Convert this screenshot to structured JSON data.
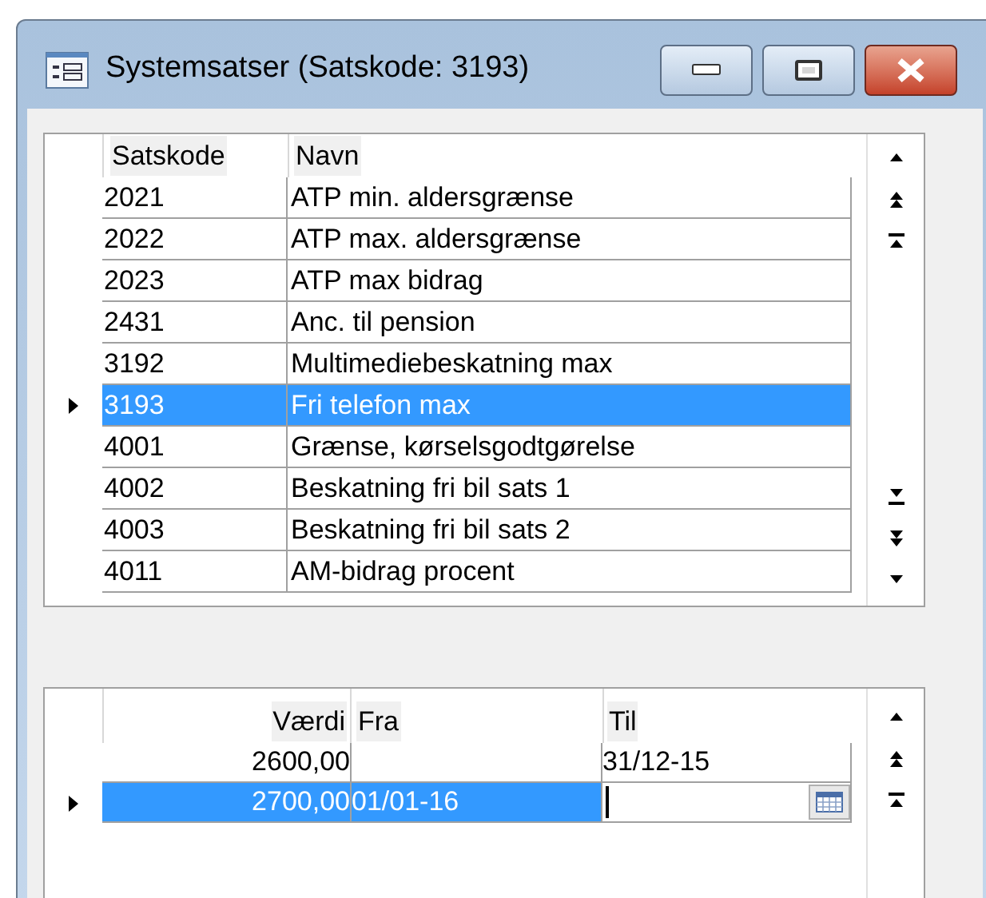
{
  "window": {
    "title": "Systemsatser (Satskode: 3193)"
  },
  "rates_grid": {
    "columns": [
      "Satskode",
      "Navn"
    ],
    "rows": [
      {
        "code": "2021",
        "name": "ATP min. aldersgrænse",
        "selected": false
      },
      {
        "code": "2022",
        "name": "ATP max. aldersgrænse",
        "selected": false
      },
      {
        "code": "2023",
        "name": "ATP max bidrag",
        "selected": false
      },
      {
        "code": "2431",
        "name": "Anc. til pension",
        "selected": false
      },
      {
        "code": "3192",
        "name": "Multimediebeskatning max",
        "selected": false
      },
      {
        "code": "3193",
        "name": "Fri telefon max",
        "selected": true
      },
      {
        "code": "4001",
        "name": "Grænse, kørselsgodtgørelse",
        "selected": false
      },
      {
        "code": "4002",
        "name": "Beskatning fri bil sats 1",
        "selected": false
      },
      {
        "code": "4003",
        "name": "Beskatning fri bil sats 2",
        "selected": false
      },
      {
        "code": "4011",
        "name": "AM-bidrag procent",
        "selected": false
      }
    ]
  },
  "values_grid": {
    "columns": [
      "Værdi",
      "Fra",
      "Til"
    ],
    "rows": [
      {
        "value": "2600,00",
        "from": "",
        "to": "31/12-15",
        "selected": false,
        "editing": false
      },
      {
        "value": "2700,00",
        "from": "01/01-16",
        "to": "",
        "selected": true,
        "editing": true
      }
    ]
  }
}
